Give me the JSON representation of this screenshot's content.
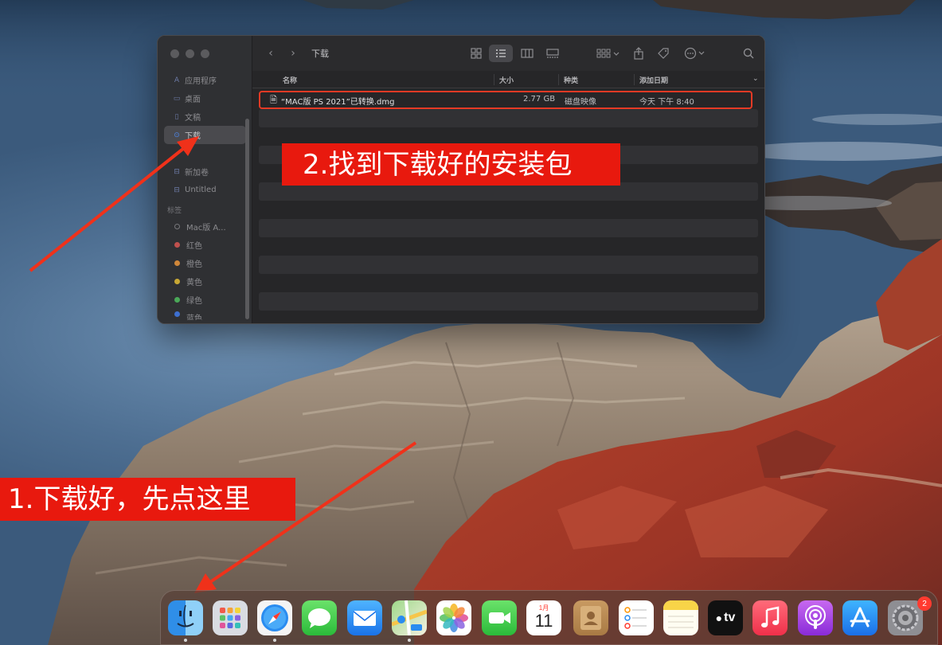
{
  "finder": {
    "title": "下载",
    "sidebar": {
      "items": [
        {
          "label": "应用程序",
          "icon": "applications-icon"
        },
        {
          "label": "桌面",
          "icon": "desktop-icon"
        },
        {
          "label": "文稿",
          "icon": "documents-icon"
        },
        {
          "label": "下载",
          "icon": "downloads-icon",
          "active": true
        },
        {
          "label": "新加卷",
          "icon": "drive-icon"
        },
        {
          "label": "Untitled",
          "icon": "drive-icon"
        }
      ],
      "tags_header": "标签",
      "tags": [
        {
          "label": "Mac版 A...",
          "color": "#2f3033"
        },
        {
          "label": "红色",
          "color": "#c0504d"
        },
        {
          "label": "橙色",
          "color": "#d0873a"
        },
        {
          "label": "黄色",
          "color": "#c8a834"
        },
        {
          "label": "绿色",
          "color": "#4aa858"
        },
        {
          "label": "蓝色",
          "color": "#3d6fd0"
        }
      ]
    },
    "columns": {
      "name": "名称",
      "size": "大小",
      "kind": "种类",
      "date_added": "添加日期"
    },
    "files": [
      {
        "name": "“MAC版 PS 2021”已转换.dmg",
        "size": "2.77 GB",
        "kind": "磁盘映像",
        "date_added": "今天 下午 8:40"
      }
    ]
  },
  "annotations": {
    "step1": "1.下载好，先点这里",
    "step2": "2.找到下载好的安装包"
  },
  "dock": {
    "calendar_month": "1月",
    "calendar_day": "11",
    "tv_label": "tv",
    "settings_badge": "2",
    "apps": [
      "finder-icon",
      "launchpad-icon",
      "safari-icon",
      "messages-icon",
      "mail-icon",
      "maps-icon",
      "photos-icon",
      "facetime-icon",
      "calendar-icon",
      "contacts-icon",
      "reminders-icon",
      "notes-icon",
      "apple-tv-icon",
      "music-icon",
      "podcasts-icon",
      "app-store-icon",
      "system-preferences-icon"
    ]
  },
  "colors": {
    "annotation_red": "#e8190e",
    "highlight_red": "#e53a25",
    "accent_blue": "#4d86e8"
  }
}
